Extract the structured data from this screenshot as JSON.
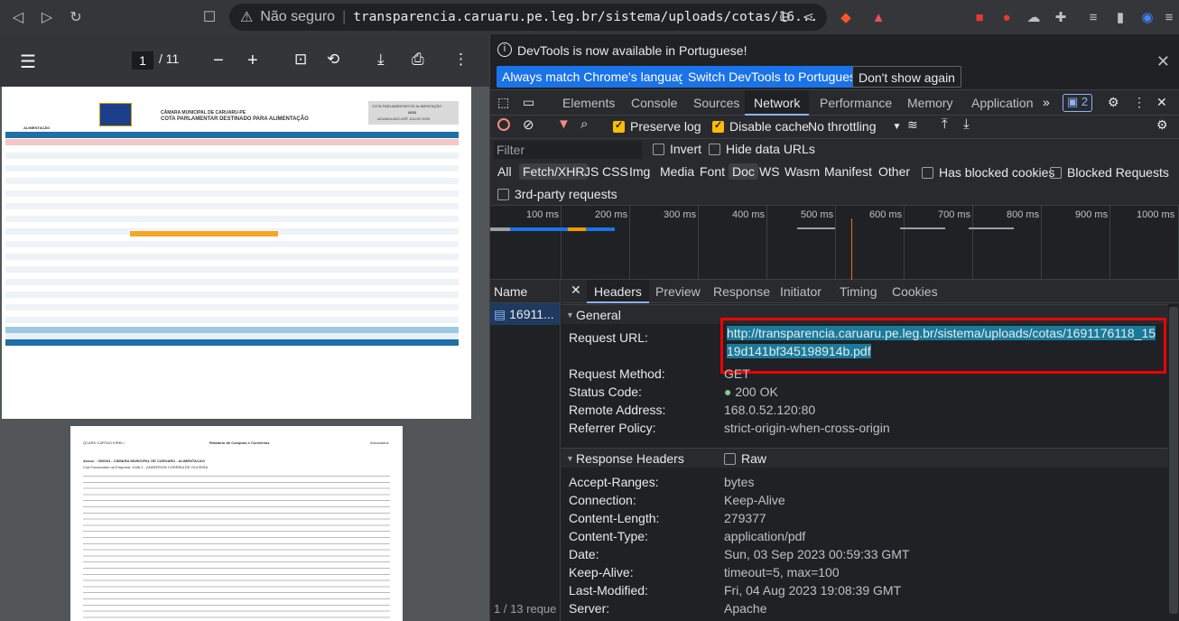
{
  "browser": {
    "insecure_label": "Não seguro",
    "url": "transparencia.caruaru.pe.leg.br/sistema/uploads/cotas/16..."
  },
  "pdf": {
    "current_page": "1",
    "total_pages": "/ 11",
    "page1": {
      "header_right_1": "COTA PARLAMENTAR DE ALIMENTAÇÃO",
      "header_right_2": "2023",
      "header_right_3": "ACUMULADO ATÉ JULHO 2023",
      "title_1": "CÂMARA MUNICIPAL DE CARUARU-PE",
      "title_2": "COTA PARLAMENTAR DESTINADO PARA ALIMENTAÇÃO",
      "section_label": "ALIMENTAÇÃO"
    },
    "page2": {
      "company": "QCARD CARTAO EIRELI",
      "report": "Relatório de Compras e Convênios",
      "associados": "Associados",
      "assoc": "Assoc. : 000064 - CÂMARA MUNICIPAL DE CARUARU - ALIMENTACAO",
      "func": "Cod.Funcionario na Empresa: 1046-1 - ANDERSON CORREIA DE OLIVEIRA"
    }
  },
  "devtools": {
    "info_message": "DevTools is now available in Portuguese!",
    "btn_match": "Always match Chrome's language",
    "btn_switch": "Switch DevTools to Portuguese",
    "btn_dont_show": "Don't show again",
    "tabs": [
      "Elements",
      "Console",
      "Sources",
      "Network",
      "Performance",
      "Memory",
      "Application"
    ],
    "issues_count": "2",
    "preserve_log": "Preserve log",
    "disable_cache": "Disable cache",
    "throttling": "No throttling",
    "filter_placeholder": "Filter",
    "invert": "Invert",
    "hide_data_urls": "Hide data URLs",
    "types": [
      "All",
      "Fetch/XHR",
      "JS",
      "CSS",
      "Img",
      "Media",
      "Font",
      "Doc",
      "WS",
      "Wasm",
      "Manifest",
      "Other"
    ],
    "has_blocked_cookies": "Has blocked cookies",
    "blocked_requests": "Blocked Requests",
    "third_party": "3rd-party requests",
    "ticks": [
      "100 ms",
      "200 ms",
      "300 ms",
      "400 ms",
      "500 ms",
      "600 ms",
      "700 ms",
      "800 ms",
      "900 ms",
      "1000 ms"
    ],
    "name_header": "Name",
    "request_name": "16911...",
    "footer": "1 / 13 reque",
    "detail_tabs": [
      "Headers",
      "Preview",
      "Response",
      "Initiator",
      "Timing",
      "Cookies"
    ],
    "general_label": "General",
    "general": {
      "request_url_label": "Request URL:",
      "request_url": "http://transparencia.caruaru.pe.leg.br/sistema/uploads/cotas/1691176118_1519d141bf345198914b.pdf",
      "method_label": "Request Method:",
      "method": "GET",
      "status_label": "Status Code:",
      "status": "200 OK",
      "remote_label": "Remote Address:",
      "remote": "168.0.52.120:80",
      "referrer_label": "Referrer Policy:",
      "referrer": "strict-origin-when-cross-origin"
    },
    "response_headers_label": "Response Headers",
    "raw_label": "Raw",
    "response_headers": [
      {
        "k": "Accept-Ranges:",
        "v": "bytes"
      },
      {
        "k": "Connection:",
        "v": "Keep-Alive"
      },
      {
        "k": "Content-Length:",
        "v": "279377"
      },
      {
        "k": "Content-Type:",
        "v": "application/pdf"
      },
      {
        "k": "Date:",
        "v": "Sun, 03 Sep 2023 00:59:33 GMT"
      },
      {
        "k": "Keep-Alive:",
        "v": "timeout=5, max=100"
      },
      {
        "k": "Last-Modified:",
        "v": "Fri, 04 Aug 2023 19:08:39 GMT"
      },
      {
        "k": "Server:",
        "v": "Apache"
      }
    ]
  }
}
